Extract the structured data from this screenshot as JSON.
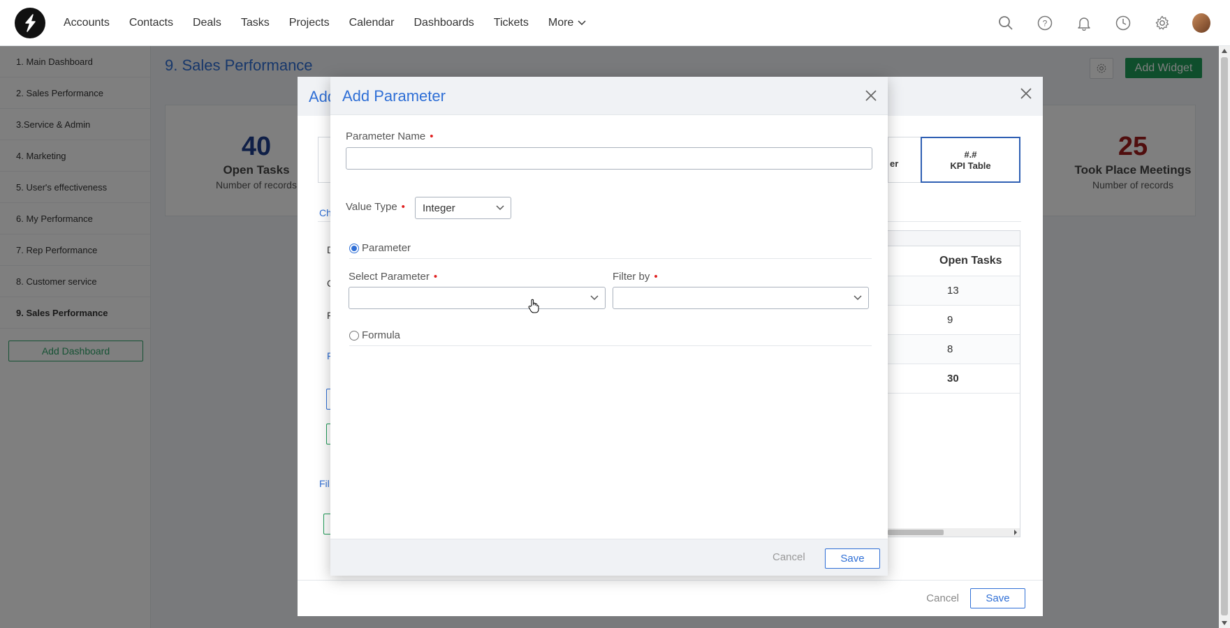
{
  "nav": {
    "items": [
      {
        "label": "Accounts"
      },
      {
        "label": "Contacts"
      },
      {
        "label": "Deals"
      },
      {
        "label": "Tasks"
      },
      {
        "label": "Projects"
      },
      {
        "label": "Calendar"
      },
      {
        "label": "Dashboards"
      },
      {
        "label": "Tickets"
      }
    ],
    "more_label": "More",
    "icons": [
      "search-icon",
      "help-icon",
      "bell-icon",
      "history-clock-icon",
      "gear-icon",
      "user-avatar"
    ]
  },
  "sidebar": {
    "items": [
      {
        "label": "1. Main Dashboard"
      },
      {
        "label": "2. Sales Performance"
      },
      {
        "label": "3.Service & Admin"
      },
      {
        "label": "4. Marketing"
      },
      {
        "label": "5. User's effectiveness"
      },
      {
        "label": "6. My Performance"
      },
      {
        "label": "7. Rep Performance"
      },
      {
        "label": "8. Customer service"
      },
      {
        "label": "9. Sales Performance"
      }
    ],
    "add_dashboard_label": "Add Dashboard"
  },
  "page": {
    "title": "9. Sales Performance",
    "add_widget_label": "Add Widget",
    "kpis": [
      {
        "value": "40",
        "label": "Open Tasks",
        "sub": "Number of records",
        "color": "#1f3f8f"
      },
      {
        "value": "25",
        "label": "Took Place Meetings",
        "sub": "Number of records",
        "color": "#a01c1c"
      }
    ]
  },
  "bg_modal": {
    "title_fragment": "Add",
    "tile_fragment": "er",
    "kpi_tile": {
      "symbol": "#.#",
      "label": "KPI Table"
    },
    "tab_fragment": "Ch",
    "letters": [
      "D",
      "C",
      "F",
      "F"
    ],
    "filter_fragment": "Fil",
    "table": {
      "header": "Open Tasks",
      "rows": [
        "13",
        "9",
        "8"
      ],
      "total": "30"
    },
    "cancel_label": "Cancel",
    "save_label": "Save"
  },
  "modal": {
    "title": "Add Parameter",
    "parameter_name_label": "Parameter Name",
    "parameter_name_value": "",
    "value_type_label": "Value Type",
    "value_type_selected": "Integer",
    "radio_parameter_label": "Parameter",
    "select_parameter_label": "Select Parameter",
    "select_parameter_value": "",
    "filter_by_label": "Filter by",
    "filter_by_value": "",
    "radio_formula_label": "Formula",
    "cancel_label": "Cancel",
    "save_label": "Save"
  },
  "colors": {
    "accent": "#2f6fd6",
    "success": "#1f9d58",
    "required": "#e02020"
  }
}
